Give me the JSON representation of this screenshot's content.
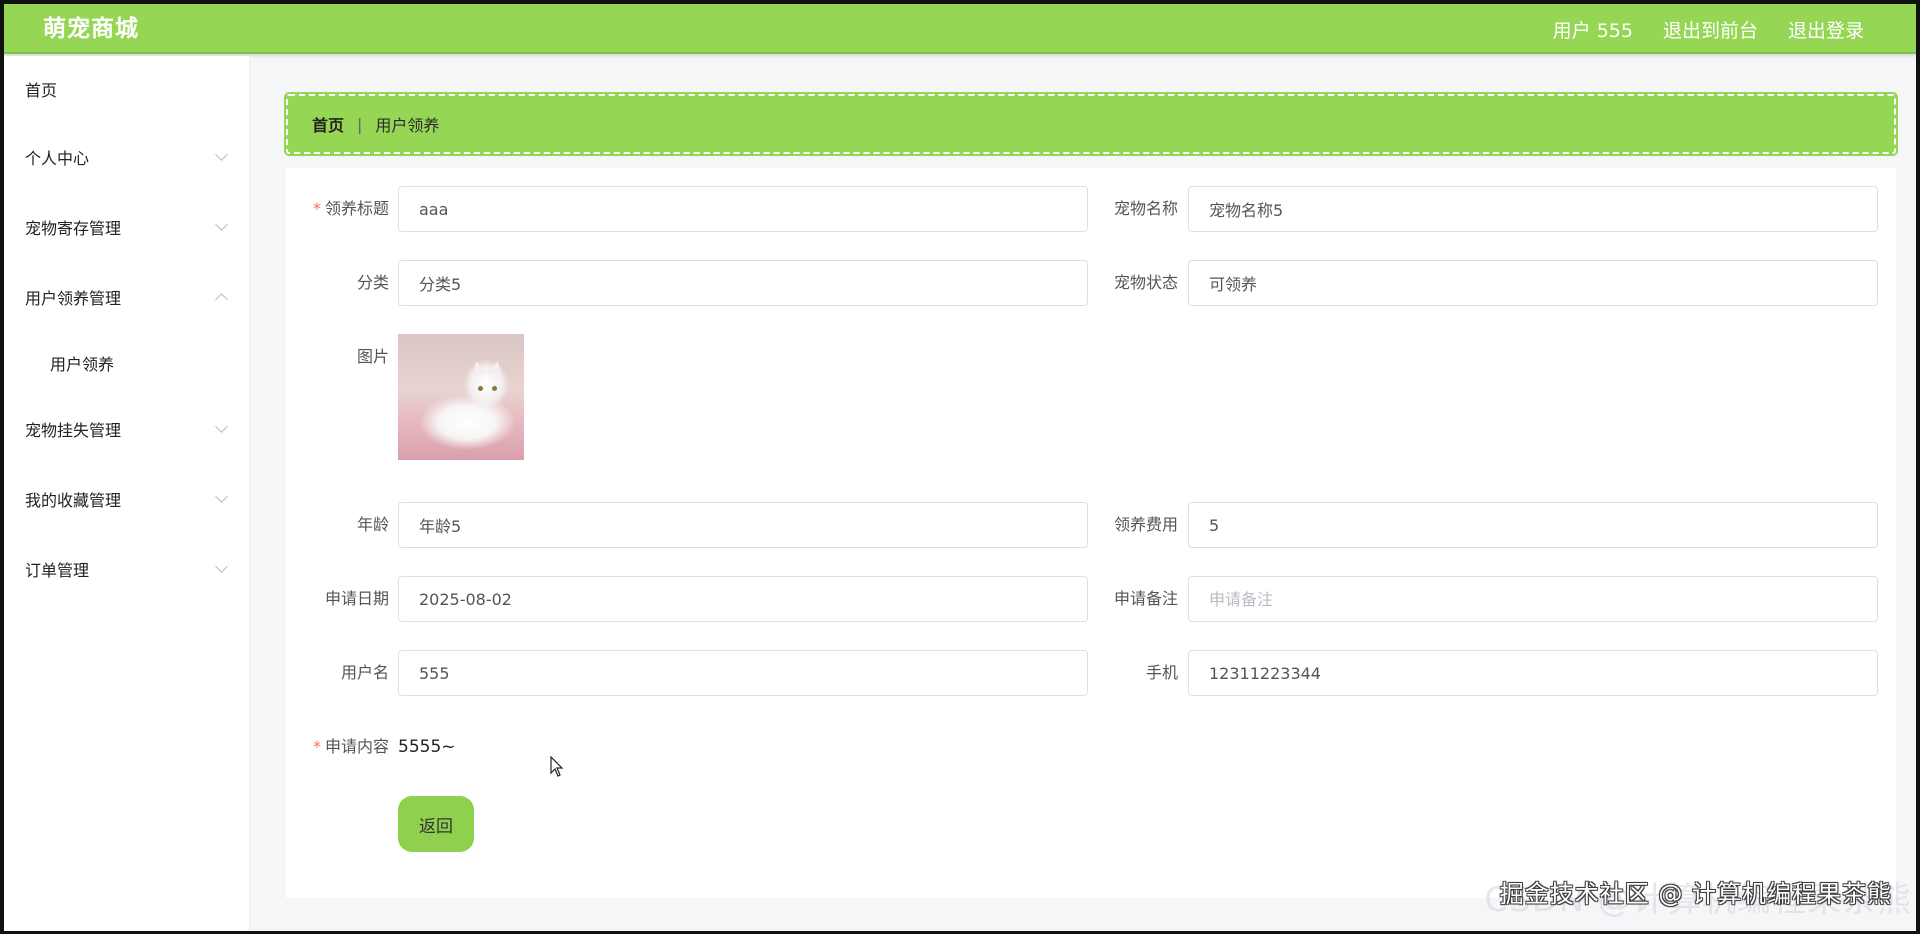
{
  "app": {
    "brand": "萌宠商城",
    "user_label": "用户 555",
    "to_front_label": "退出到前台",
    "logout_label": "退出登录",
    "accent_color": "#95d755"
  },
  "sidebar": {
    "items": [
      {
        "label": "首页"
      },
      {
        "label": "个人中心"
      },
      {
        "label": "宠物寄存管理"
      },
      {
        "label": "用户领养管理"
      },
      {
        "label": "用户领养"
      },
      {
        "label": "宠物挂失管理"
      },
      {
        "label": "我的收藏管理"
      },
      {
        "label": "订单管理"
      }
    ]
  },
  "breadcrumb": {
    "home": "首页",
    "current": "用户领养"
  },
  "form": {
    "title_label": "领养标题",
    "title_value": "aaa",
    "pet_name_label": "宠物名称",
    "pet_name_value": "宠物名称5",
    "category_label": "分类",
    "category_value": "分类5",
    "status_label": "宠物状态",
    "status_value": "可领养",
    "image_label": "图片",
    "age_label": "年龄",
    "age_value": "年龄5",
    "fee_label": "领养费用",
    "fee_value": "5",
    "date_label": "申请日期",
    "date_value": "2025-08-02",
    "remark_label": "申请备注",
    "remark_placeholder": "申请备注",
    "username_label": "用户名",
    "username_value": "555",
    "phone_label": "手机",
    "phone_value": "12311223344",
    "content_label": "申请内容",
    "content_value": "5555~",
    "back_label": "返回",
    "required_mark": "*"
  },
  "watermark": {
    "text": "掘金技术社区 @ 计算机编程果茶熊",
    "ghost": "CSDN @计算机编程果茶熊"
  }
}
